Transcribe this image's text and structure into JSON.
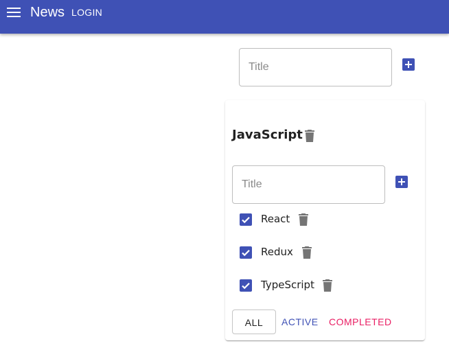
{
  "appbar": {
    "menu_icon": "hamburger-menu-icon",
    "brand": "News",
    "login_label": "LOGIN",
    "color": "#3f51b5"
  },
  "new_list": {
    "placeholder": "Title",
    "add_icon": "add-box-icon"
  },
  "todolist": {
    "title": "JavaScript",
    "delete_icon": "trash-icon",
    "new_task_placeholder": "Title",
    "tasks": [
      {
        "label": "React",
        "checked": true
      },
      {
        "label": "Redux",
        "checked": true
      },
      {
        "label": "TypeScript",
        "checked": true
      }
    ],
    "filters": {
      "all": "ALL",
      "active": "ACTIVE",
      "completed": "COMPLETED",
      "selected": "ALL"
    }
  },
  "colors": {
    "primary": "#3f51b5",
    "secondary": "#e91e63",
    "icon_gray": "#757575"
  }
}
